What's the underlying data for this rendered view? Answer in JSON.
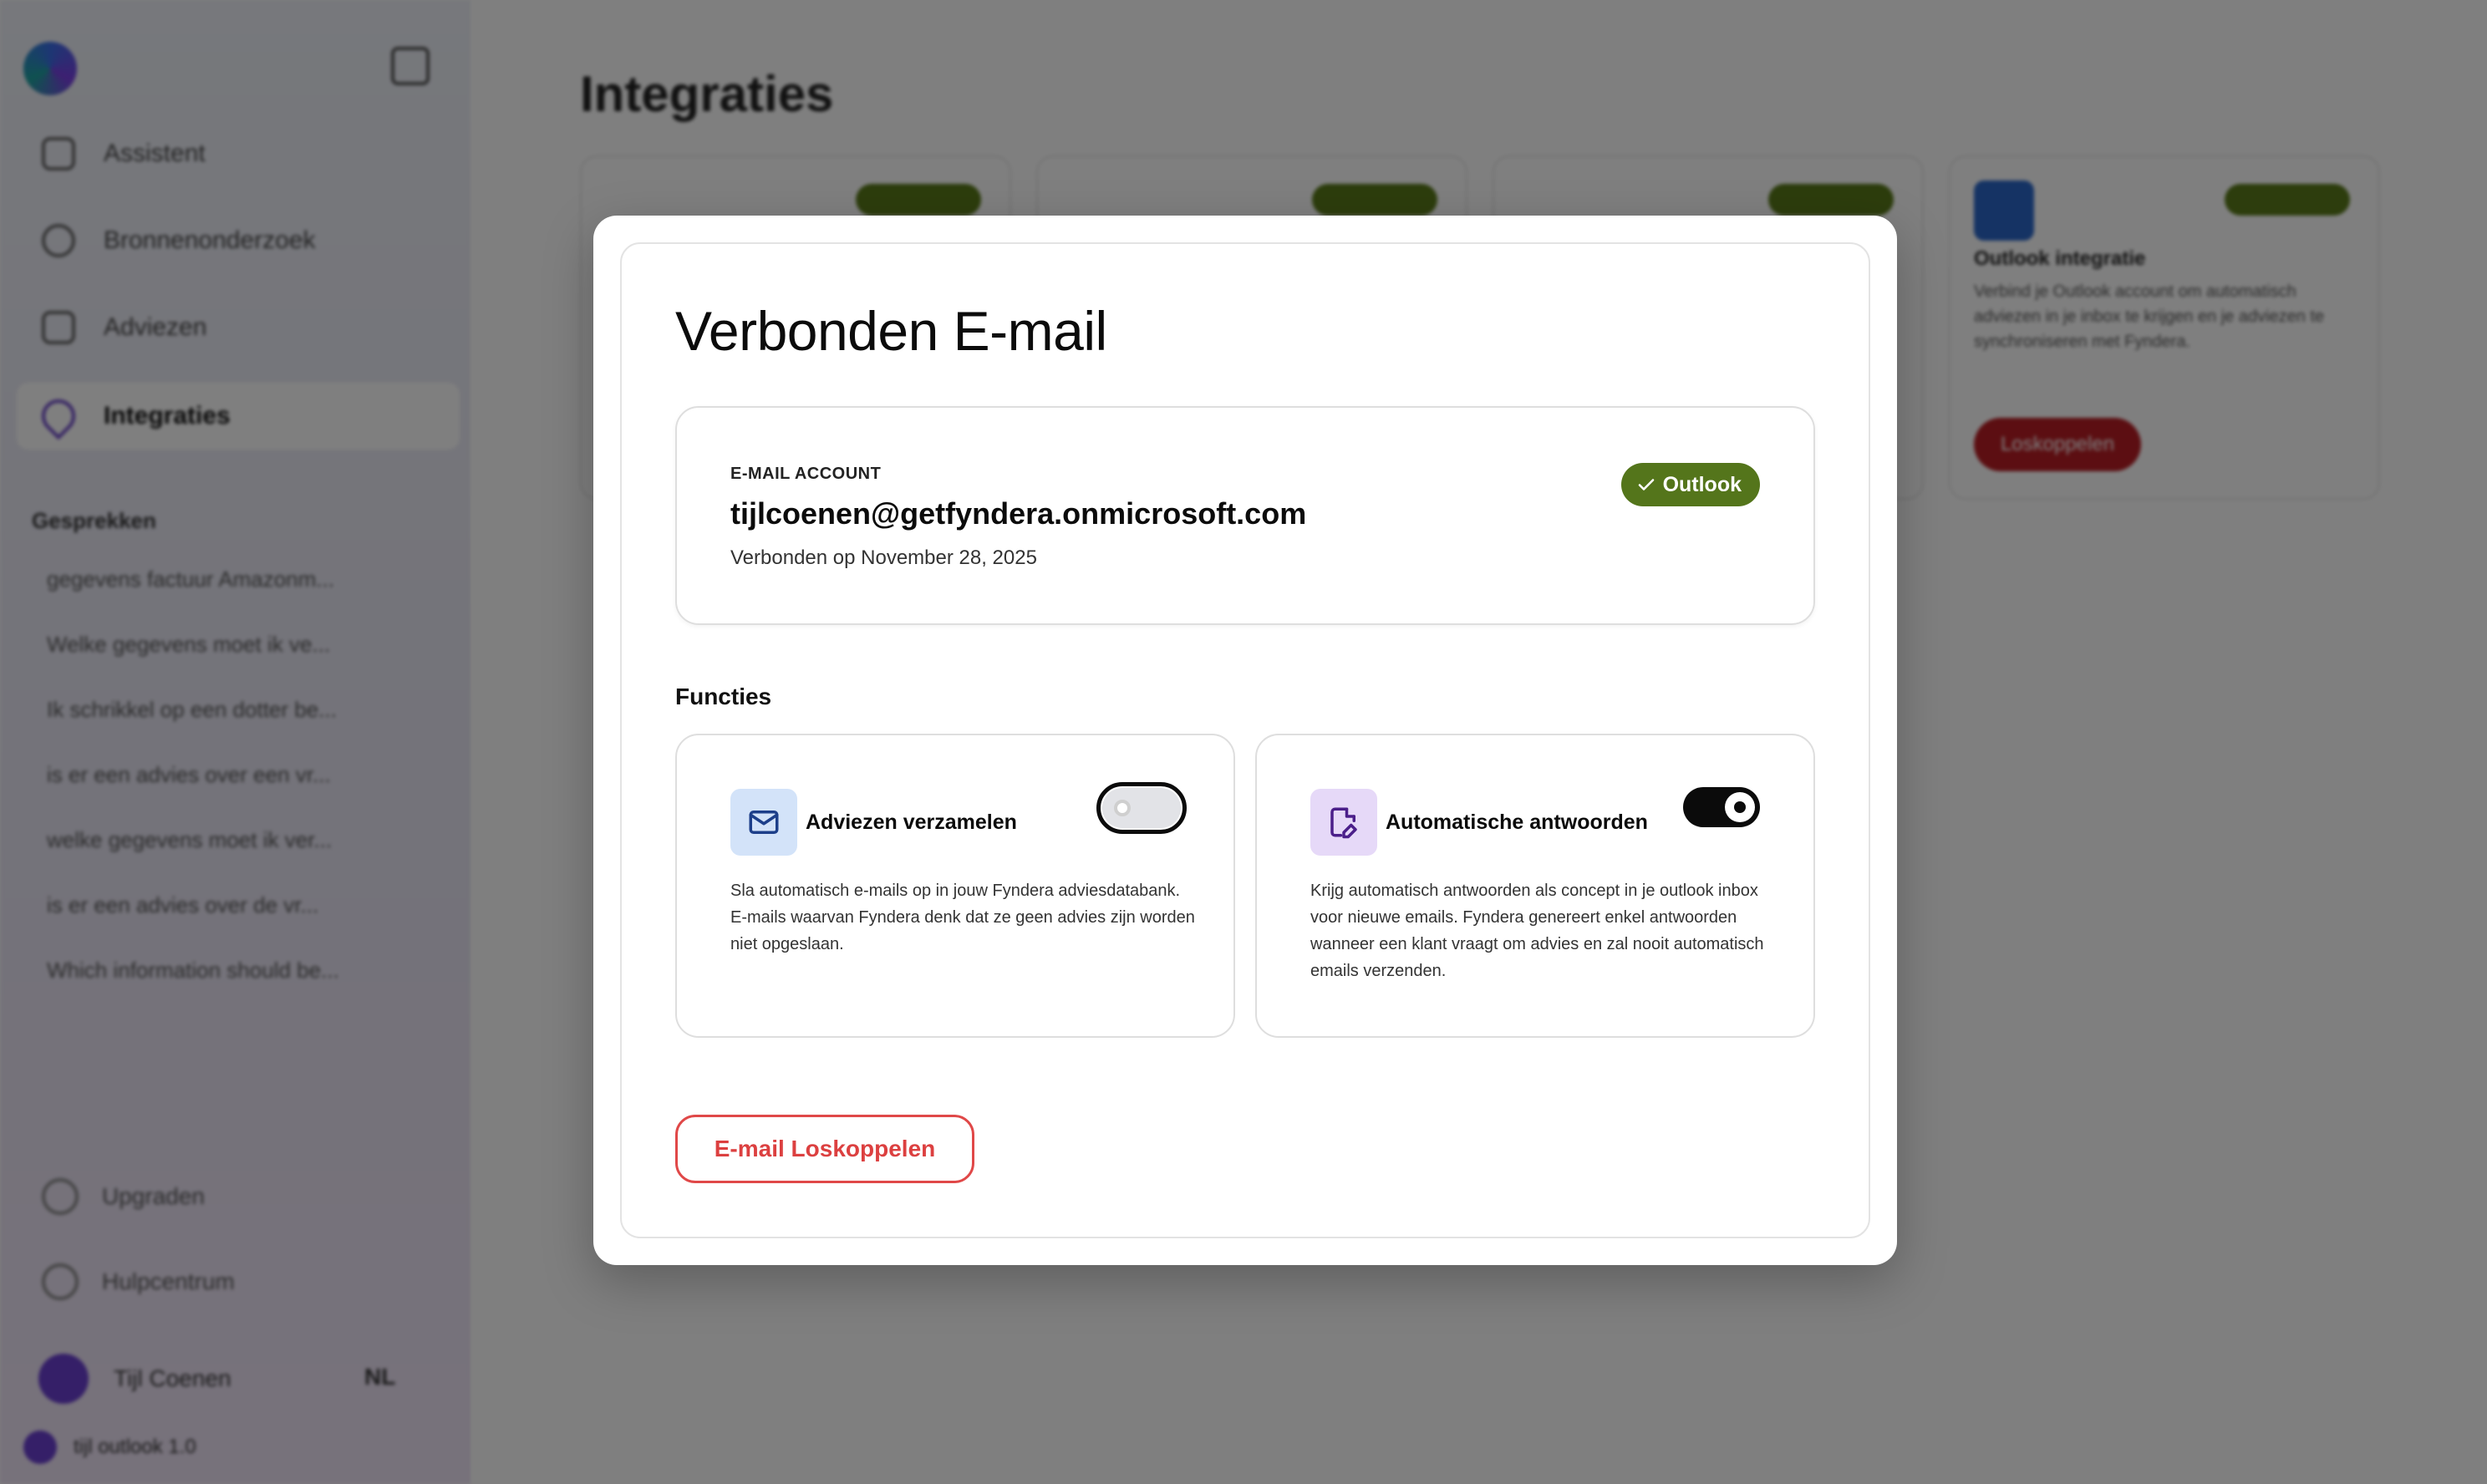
{
  "sidebar": {
    "nav": [
      {
        "label": "Assistent",
        "icon": "home-icon"
      },
      {
        "label": "Bronnenonderzoek",
        "icon": "search-icon"
      },
      {
        "label": "Adviezen",
        "icon": "advice-icon"
      },
      {
        "label": "Integraties",
        "icon": "integrations-icon"
      }
    ],
    "section_label": "Gesprekken",
    "conversations": [
      "gegevens factuur Amazonm...",
      "Welke gegevens moet ik ve...",
      "Ik schrikkel op een dotter be...",
      "is er een advies over een vr...",
      "welke gegevens moet ik ver...",
      "is er een advies over de vr...",
      "Which information should be..."
    ],
    "bottom": [
      {
        "label": "Upgraden",
        "icon": "upgrade-icon"
      },
      {
        "label": "Hulpcentrum",
        "icon": "help-icon"
      }
    ],
    "user_name": "Tijl Coenen",
    "language": "NL",
    "plan": "tijl outlook 1.0"
  },
  "main": {
    "title": "Integraties",
    "outlook_card": {
      "title": "Outlook integratie",
      "description": "Verbind je Outlook account om automatisch adviezen in je inbox te krijgen en je adviezen te synchroniseren met Fyndera.",
      "button": "Loskoppelen"
    }
  },
  "modal": {
    "title": "Verbonden E-mail",
    "account": {
      "label": "E-MAIL ACCOUNT",
      "email": "tijlcoenen@getfyndera.onmicrosoft.com",
      "connected_on": "Verbonden op November 28, 2025",
      "provider_badge": "Outlook",
      "badge_color": "#54751b"
    },
    "functions_label": "Functies",
    "features": [
      {
        "title": "Adviezen verzamelen",
        "icon": "mail-icon",
        "description": "Sla automatisch e-mails op in jouw Fyndera adviesdatabank. E-mails waarvan Fyndera denk dat ze geen advies zijn worden niet opgeslaan.",
        "enabled": false
      },
      {
        "title": "Automatische antwoorden",
        "icon": "file-signature-icon",
        "description": "Krijg automatisch antwoorden als concept in je outlook inbox voor nieuwe emails. Fyndera genereert enkel antwoorden wanneer een klant vraagt om advies en zal nooit automatisch emails verzenden.",
        "enabled": true
      }
    ],
    "disconnect_button": "E-mail Loskoppelen",
    "danger_color": "#dc4040"
  }
}
